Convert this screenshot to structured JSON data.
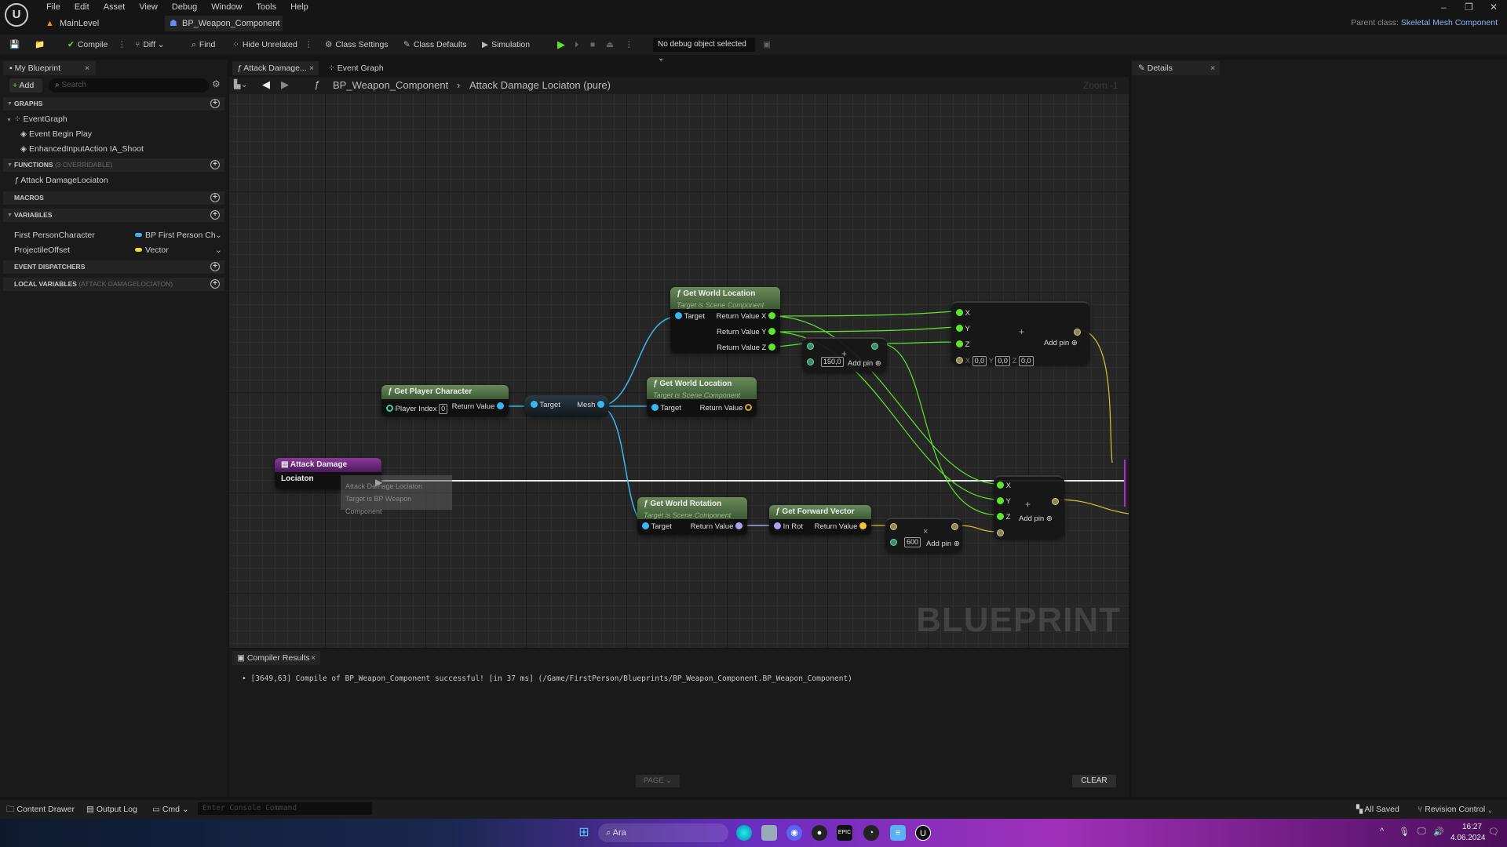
{
  "titlebar": {
    "menu": [
      "File",
      "Edit",
      "Asset",
      "View",
      "Debug",
      "Window",
      "Tools",
      "Help"
    ],
    "tabs": [
      {
        "label": "MainLevel",
        "active": false
      },
      {
        "label": "BP_Weapon_Component",
        "active": true
      }
    ],
    "parent_class_label": "Parent class:",
    "parent_class_value": "Skeletal Mesh Component",
    "window_controls": {
      "minimize": "–",
      "restore": "❐",
      "close": "✕"
    }
  },
  "toolbar": {
    "compile": "Compile",
    "diff": "Diff",
    "find": "Find",
    "hide_unrelated": "Hide Unrelated",
    "class_settings": "Class Settings",
    "class_defaults": "Class Defaults",
    "simulation": "Simulation",
    "debug_object": "No debug object selected"
  },
  "my_blueprint": {
    "tab_label": "My Blueprint",
    "add_label": "Add",
    "search_placeholder": "Search",
    "sections": {
      "graphs": "GRAPHS",
      "functions": "FUNCTIONS",
      "functions_sub": "(3 OVERRIDABLE)",
      "macros": "MACROS",
      "variables": "VARIABLES",
      "event_dispatchers": "EVENT DISPATCHERS",
      "local_variables": "LOCAL VARIABLES",
      "local_variables_sub": "(ATTACK DAMAGELOCIATON)"
    },
    "graphs": {
      "event_graph": "EventGraph",
      "events": [
        "Event Begin Play",
        "EnhancedInputAction IA_Shoot"
      ]
    },
    "functions": [
      "Attack DamageLociaton"
    ],
    "variables": [
      {
        "name": "First PersonCharacter",
        "type": "BP First Person Ch",
        "color": "#3ab8ee"
      },
      {
        "name": "ProjectileOffset",
        "type": "Vector",
        "color": "#f1d53a"
      }
    ]
  },
  "editor_tabs": [
    {
      "label": "Attack Damage...",
      "active": true
    },
    {
      "label": "Event Graph",
      "active": false
    }
  ],
  "breadcrumb": {
    "root": "BP_Weapon_Component",
    "separator": "›",
    "current": "Attack Damage Lociaton (pure)",
    "zoom": "Zoom -1"
  },
  "graph": {
    "watermark": "BLUEPRINT",
    "nodes": {
      "get_world_location_1": {
        "title": "Get World Location",
        "sub": "Target is Scene Component",
        "in": "Target",
        "outs": [
          "Return Value X",
          "Return Value Y",
          "Return Value Z"
        ]
      },
      "add_float": {
        "value": "150,0",
        "add_pin": "Add pin"
      },
      "make_vector_add": {
        "pins": [
          "X",
          "Y",
          "Z"
        ],
        "x_label": "X",
        "y_label": "Y",
        "z_label": "Z",
        "x": "0,0",
        "y": "0,0",
        "z": "0,0",
        "add_pin": "Add pin"
      },
      "get_player_character": {
        "title": "Get Player Character",
        "in": "Player Index",
        "index": "0",
        "out": "Return Value"
      },
      "get_mesh": {
        "in": "Target",
        "out": "Mesh"
      },
      "get_world_location_2": {
        "title": "Get World Location",
        "sub": "Target is Scene Component",
        "in": "Target",
        "out": "Return Value"
      },
      "function_entry": {
        "title": "Attack Damage Lociaton",
        "tooltip_line1": "Attack Damage Lociaton",
        "tooltip_line2": "Target is BP Weapon Component"
      },
      "get_world_rotation": {
        "title": "Get World Rotation",
        "sub": "Target is Scene Component",
        "in": "Target",
        "out": "Return Value"
      },
      "get_forward_vector": {
        "title": "Get Forward Vector",
        "in": "In Rot",
        "out": "Return Value"
      },
      "multiply": {
        "value": "600",
        "add_pin": "Add pin"
      },
      "add_vector": {
        "pins": [
          "X",
          "Y",
          "Z"
        ],
        "add_pin": "Add pin"
      }
    }
  },
  "details": {
    "tab_label": "Details"
  },
  "compiler": {
    "tab_label": "Compiler Results",
    "message": "[3649,63] Compile of BP_Weapon_Component successful! [in 37 ms] (/Game/FirstPerson/Blueprints/BP_Weapon_Component.BP_Weapon_Component)",
    "page_label": "PAGE",
    "clear_label": "CLEAR"
  },
  "statusbar": {
    "content_drawer": "Content Drawer",
    "output_log": "Output Log",
    "cmd": "Cmd",
    "console_placeholder": "Enter Console Command",
    "all_saved": "All Saved",
    "revision_control": "Revision Control"
  },
  "taskbar": {
    "search_placeholder": "Ara",
    "time": "16:27",
    "date": "4.06.2024"
  }
}
